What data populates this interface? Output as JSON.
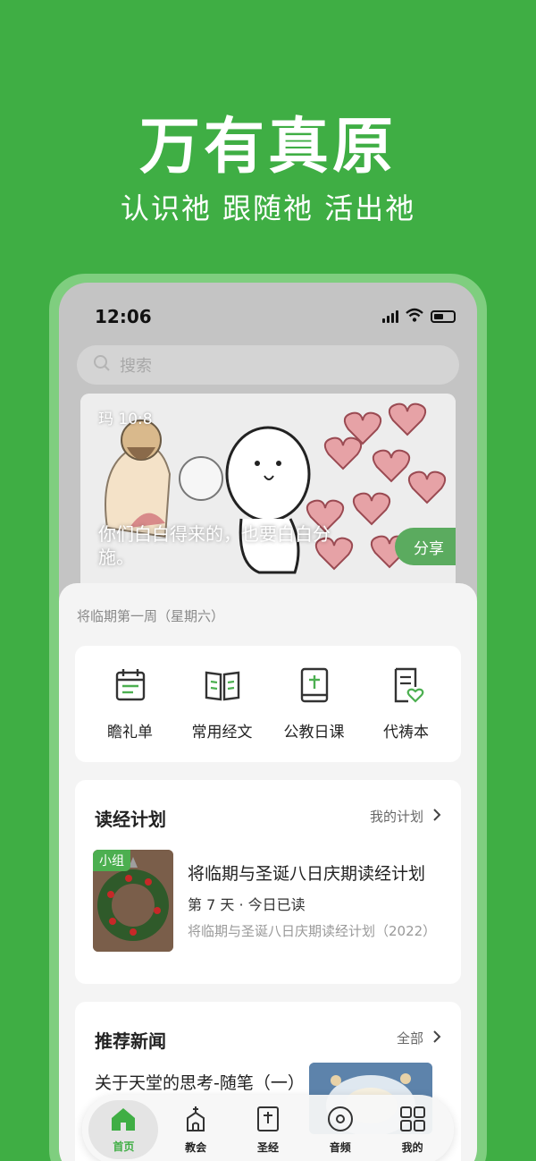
{
  "promo": {
    "title": "万有真原",
    "subtitle": "认识祂 跟随祂 活出祂"
  },
  "status_bar": {
    "time": "12:06"
  },
  "search": {
    "placeholder": "搜索"
  },
  "banner": {
    "reference": "玛 10:8",
    "verse": "你们白白得来的，也要白白分施。",
    "share_label": "分享"
  },
  "season_label": "将临期第一周（星期六）",
  "quick_actions": [
    {
      "label": "瞻礼单",
      "icon": "calendar-list-icon"
    },
    {
      "label": "常用经文",
      "icon": "open-book-icon"
    },
    {
      "label": "公教日课",
      "icon": "bible-cross-icon"
    },
    {
      "label": "代祷本",
      "icon": "prayer-heart-icon"
    }
  ],
  "reading_plan": {
    "section_title": "读经计划",
    "link_label": "我的计划",
    "badge": "小组",
    "title": "将临期与圣诞八日庆期读经计划",
    "progress": "第 7 天 · 今日已读",
    "subtitle": "将临期与圣诞八日庆期读经计划（2022）"
  },
  "news": {
    "section_title": "推荐新闻",
    "link_label": "全部",
    "item_title": "关于天堂的思考-随笔（一）"
  },
  "tabs": [
    {
      "label": "首页",
      "icon": "home-icon",
      "active": true
    },
    {
      "label": "教会",
      "icon": "church-icon",
      "active": false
    },
    {
      "label": "圣经",
      "icon": "bible-icon",
      "active": false
    },
    {
      "label": "音频",
      "icon": "audio-disc-icon",
      "active": false
    },
    {
      "label": "我的",
      "icon": "profile-grid-icon",
      "active": false
    }
  ],
  "colors": {
    "brand_green": "#3fae44",
    "active_tab": "#3fae44"
  }
}
